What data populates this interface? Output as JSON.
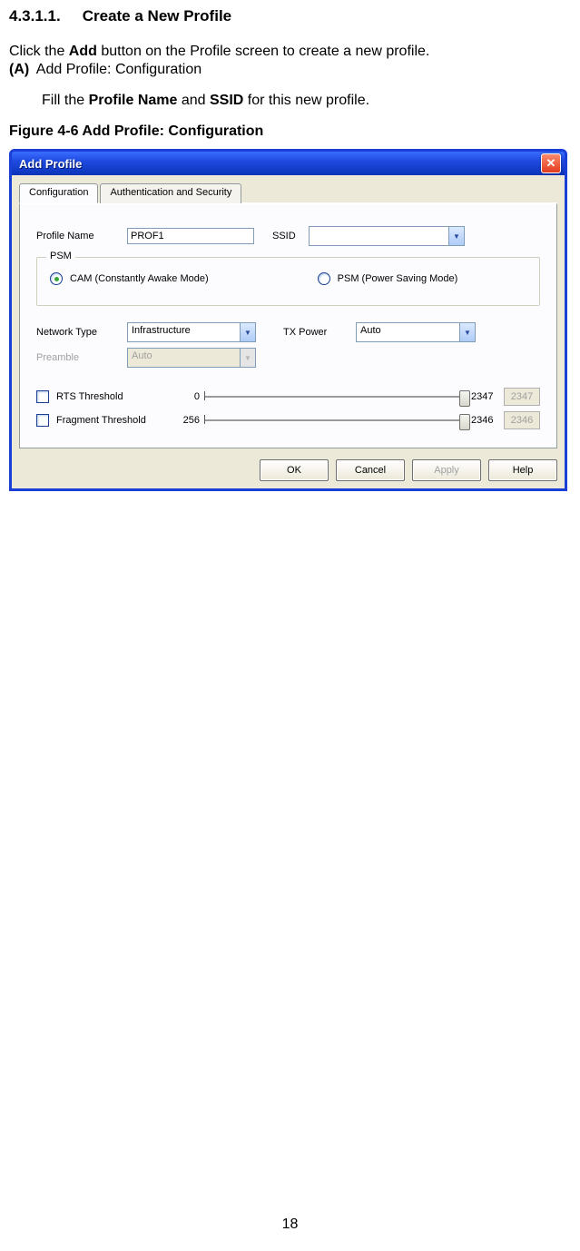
{
  "doc": {
    "section_num": "4.3.1.1.",
    "section_title": "Create a New Profile",
    "intro_a": "Click the ",
    "intro_bold": "Add",
    "intro_b": " button on the Profile screen to create a new profile.",
    "item_tag": "(A)",
    "item_text": " Add Profile: Configuration",
    "indent_a": "Fill the ",
    "indent_bold1": "Profile Name",
    "indent_mid": " and ",
    "indent_bold2": "SSID",
    "indent_b": " for this new profile.",
    "figure": "Figure 4-6 Add Profile: Configuration",
    "page_number": "18"
  },
  "window": {
    "title": "Add Profile",
    "tabs": {
      "config": "Configuration",
      "auth": "Authentication and Security"
    },
    "labels": {
      "profile_name": "Profile Name",
      "ssid": "SSID",
      "psm_group": "PSM",
      "cam": "CAM (Constantly Awake Mode)",
      "psm": "PSM (Power Saving Mode)",
      "network_type": "Network Type",
      "tx_power": "TX Power",
      "preamble": "Preamble",
      "rts": "RTS Threshold",
      "frag": "Fragment Threshold"
    },
    "values": {
      "profile_name": "PROF1",
      "ssid": "",
      "network_type": "Infrastructure",
      "tx_power": "Auto",
      "preamble": "Auto",
      "rts_lo": "0",
      "rts_hi": "2347",
      "rts_val": "2347",
      "frag_lo": "256",
      "frag_hi": "2346",
      "frag_val": "2346"
    },
    "buttons": {
      "ok": "OK",
      "cancel": "Cancel",
      "apply": "Apply",
      "help": "Help"
    }
  }
}
